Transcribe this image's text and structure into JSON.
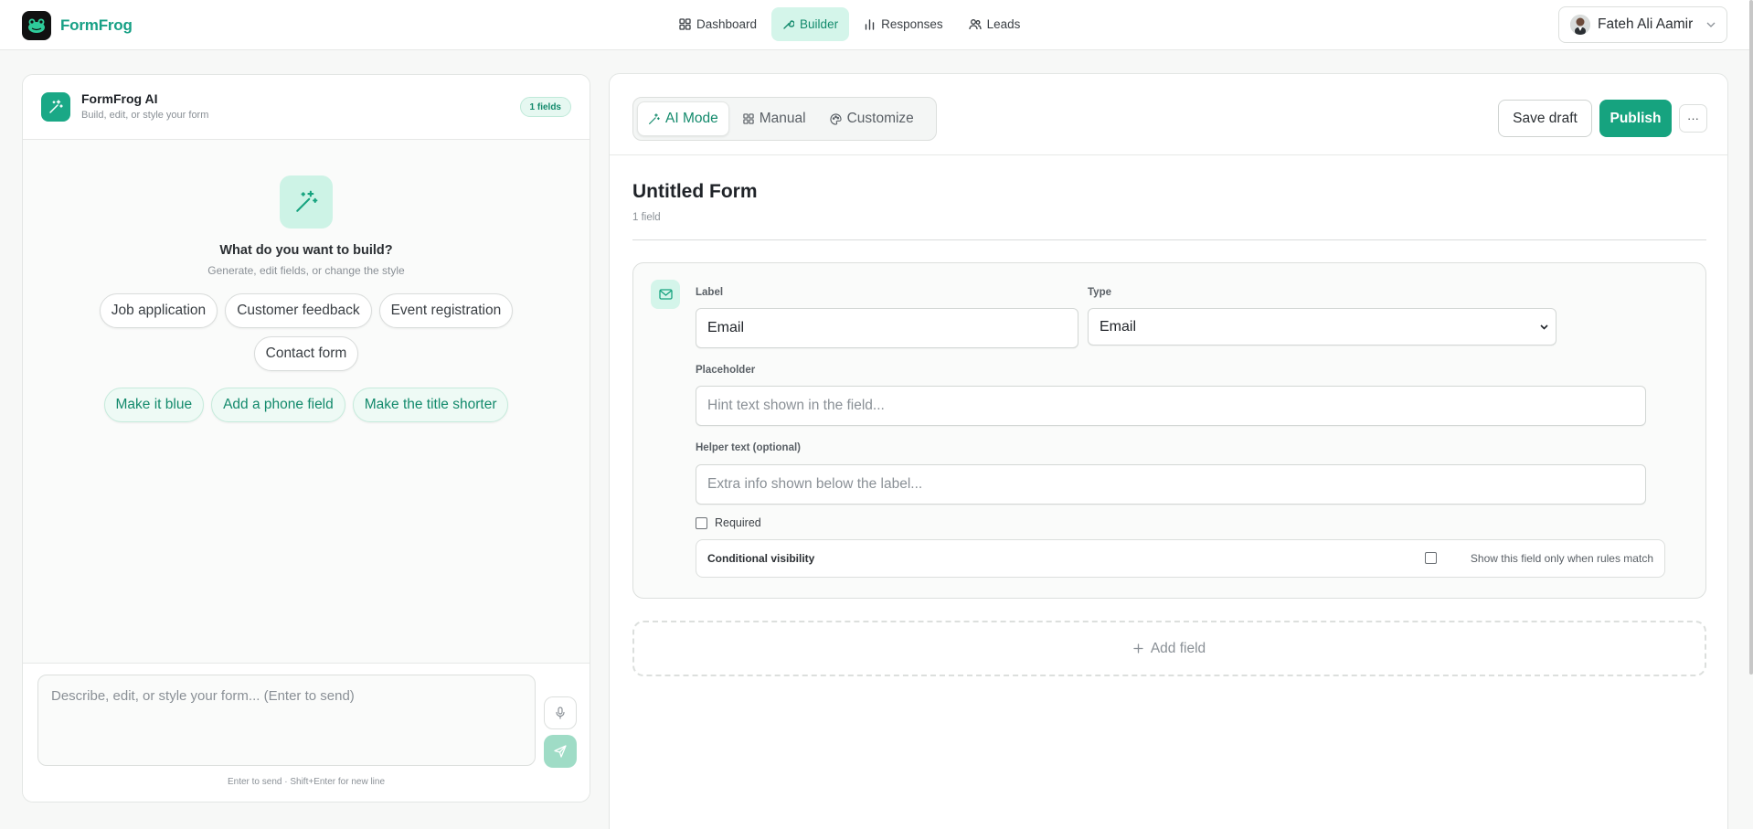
{
  "brand": {
    "name": "FormFrog"
  },
  "nav": {
    "items": [
      {
        "label": "Dashboard",
        "icon": "grid-icon"
      },
      {
        "label": "Builder",
        "icon": "wrench-icon",
        "active": true
      },
      {
        "label": "Responses",
        "icon": "bar-chart-icon"
      },
      {
        "label": "Leads",
        "icon": "users-icon"
      }
    ]
  },
  "user": {
    "name": "Fateh Ali Aamir"
  },
  "ai": {
    "title": "FormFrog AI",
    "subtitle": "Build, edit, or style your form",
    "fields_badge": "1 fields",
    "question": "What do you want to build?",
    "hint": "Generate, edit fields, or change the style",
    "templates": [
      "Job application",
      "Customer feedback",
      "Event registration",
      "Contact form"
    ],
    "suggestions": [
      "Make it blue",
      "Add a phone field",
      "Make the title shorter"
    ],
    "prompt_placeholder": "Describe, edit, or style your form... (Enter to send)",
    "footer_hint": "Enter to send · Shift+Enter for new line"
  },
  "builder": {
    "modes": [
      {
        "label": "AI Mode",
        "icon": "magic-wand-icon",
        "active": true
      },
      {
        "label": "Manual",
        "icon": "grid-icon"
      },
      {
        "label": "Customize",
        "icon": "palette-icon"
      }
    ],
    "save_label": "Save draft",
    "publish_label": "Publish",
    "more_label": "···",
    "form_title": "Untitled Form",
    "field_count": "1 field",
    "field": {
      "label_caption": "Label",
      "label_value": "Email",
      "type_caption": "Type",
      "type_value": "Email",
      "placeholder_caption": "Placeholder",
      "placeholder_hint": "Hint text shown in the field...",
      "helper_caption": "Helper text (optional)",
      "helper_hint": "Extra info shown below the label...",
      "required_label": "Required",
      "required_checked": false,
      "conditional_label": "Conditional visibility",
      "conditional_rule": "Show this field only when rules match",
      "conditional_checked": false
    },
    "add_field_label": "Add field"
  },
  "colors": {
    "accent": "#16a37f",
    "accent_light": "#d4f5ea",
    "brand_text": "#16a085"
  }
}
